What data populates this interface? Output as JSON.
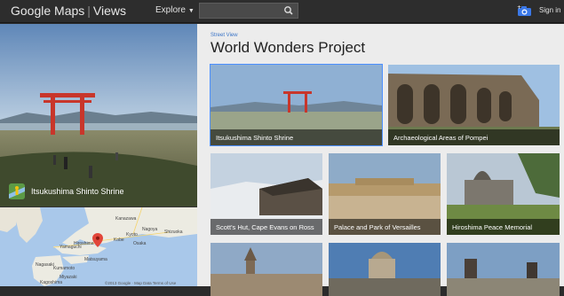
{
  "header": {
    "brand_google": "Google",
    "brand_maps": "Maps",
    "brand_views": "Views",
    "explore_label": "Explore",
    "search_value": "",
    "signin_label": "Sign in"
  },
  "hero": {
    "caption": "Itsukushima Shinto Shrine"
  },
  "map": {
    "labels": [
      "Kanazawa",
      "Shizuoka",
      "Nagoya",
      "Kobe",
      "Yamaguchi",
      "Hiroshima",
      "Matsuyama",
      "Nagasaki",
      "Kumamoto",
      "Miyazaki",
      "Kagoshima",
      "Osaka",
      "Kyoto"
    ],
    "attribution": "©2013 Google · Map Data  Terms of Use"
  },
  "main": {
    "breadcrumb": "Street View",
    "title": "World Wonders Project",
    "tiles": [
      {
        "label": "Itsukushima Shinto Shrine"
      },
      {
        "label": "Archaeological Areas of Pompei"
      },
      {
        "label": "Scott's Hut, Cape Evans on Ross"
      },
      {
        "label": "Palace and Park of Versailles"
      },
      {
        "label": "Hiroshima Peace Memorial"
      },
      {
        "label": ""
      },
      {
        "label": ""
      },
      {
        "label": ""
      }
    ]
  },
  "colors": {
    "accent_blue": "#4d90fe",
    "link_blue": "#3a74c7",
    "topbar": "#2d2d2d",
    "content_bg": "#ececec"
  }
}
